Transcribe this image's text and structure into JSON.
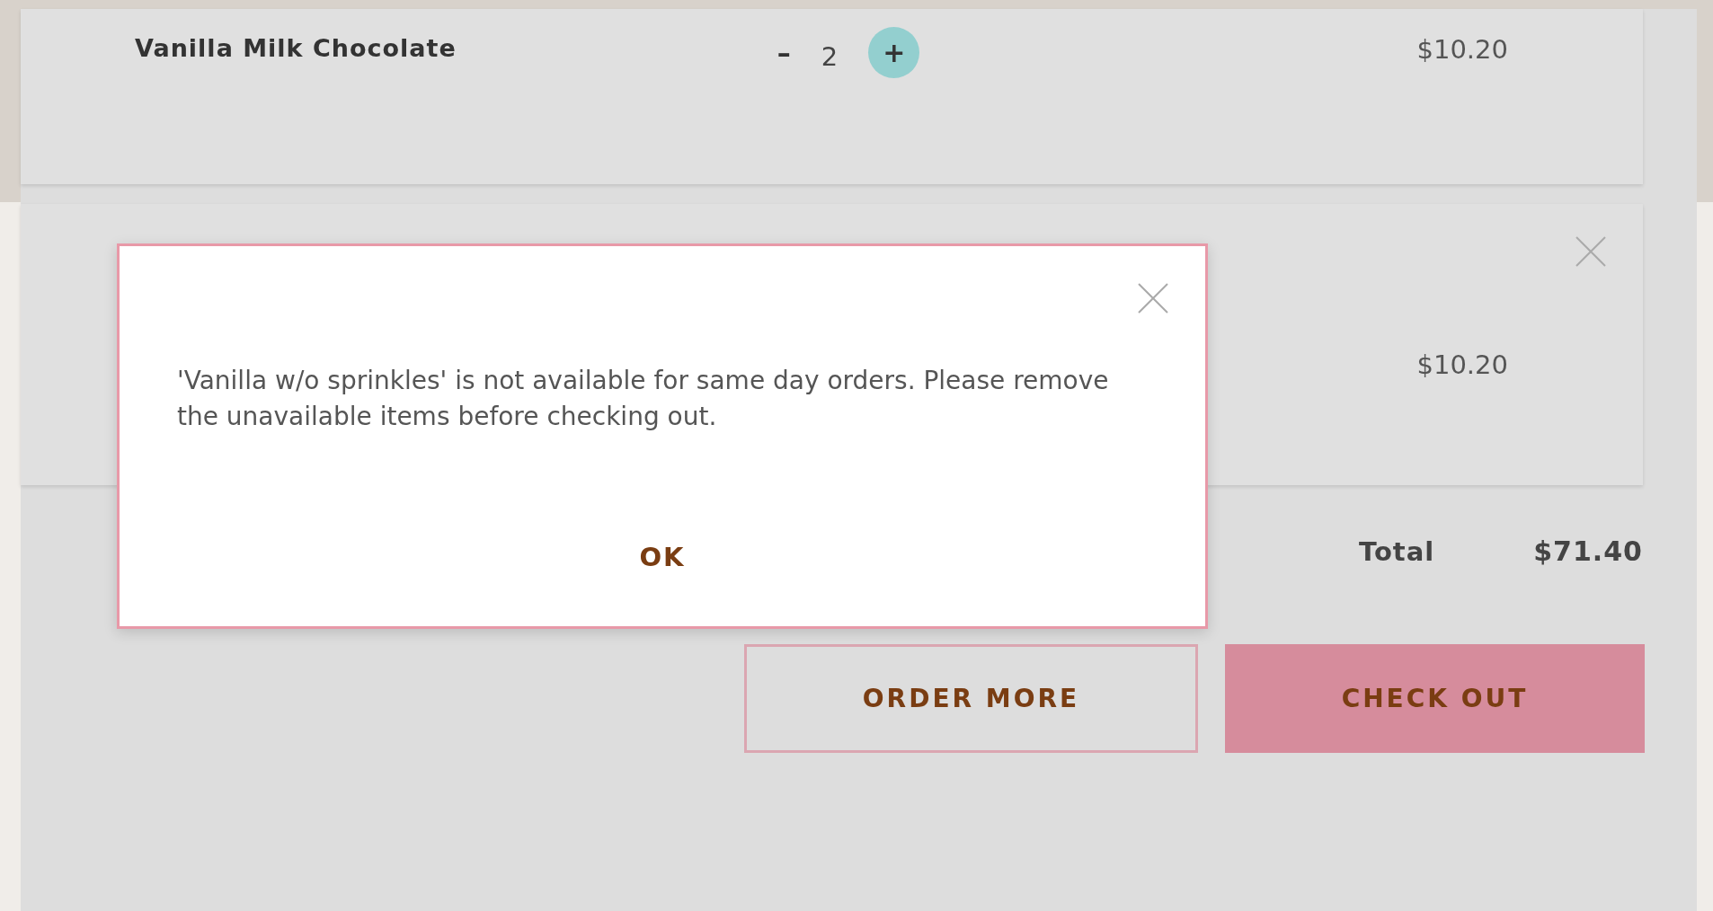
{
  "cart_items": [
    {
      "name": "Vanilla Milk Chocolate",
      "decrease": "–",
      "quantity": "2",
      "increase": "+",
      "price": "$10.20",
      "removable": false
    },
    {
      "price": "$10.20",
      "removable": true
    }
  ],
  "total": {
    "label": "Total",
    "amount": "$71.40"
  },
  "actions": [
    {
      "label": "ORDER MORE",
      "kind": "outline"
    },
    {
      "label": "CHECK OUT",
      "kind": "primary"
    }
  ],
  "dialog": {
    "message": "'Vanilla w/o sprinkles' is not available for same day orders. Please remove the unavailable items before checking out.",
    "button": "OK"
  }
}
